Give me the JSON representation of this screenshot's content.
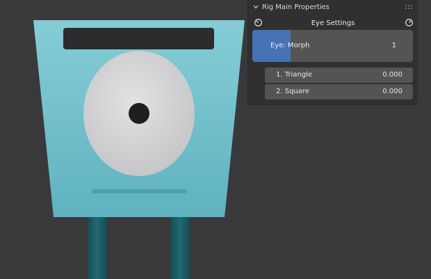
{
  "panel": {
    "title": "Rig Main Properties",
    "section_title": "Eye Settings",
    "icons": {
      "collapse": "chevron-down-icon",
      "drag": "drag-handle-icon",
      "reset_left": "reset-icon",
      "reset_right": "reset-icon"
    },
    "morph": {
      "label": "Eye: Morph",
      "value": "1",
      "fill_fraction": 0.24
    },
    "fields": [
      {
        "label": "1. Triangle",
        "value": "0.000"
      },
      {
        "label": "2. Square",
        "value": "0.000"
      }
    ]
  },
  "colors": {
    "viewport_bg": "#39393b",
    "panel_bg": "#303030",
    "slider_bg": "#545454",
    "accent": "#4772b3",
    "character_body": "#7ec6d0",
    "character_dark": "#2c2c2e",
    "eye_white": "#d4d4d6",
    "legs": "#1e5f66"
  }
}
